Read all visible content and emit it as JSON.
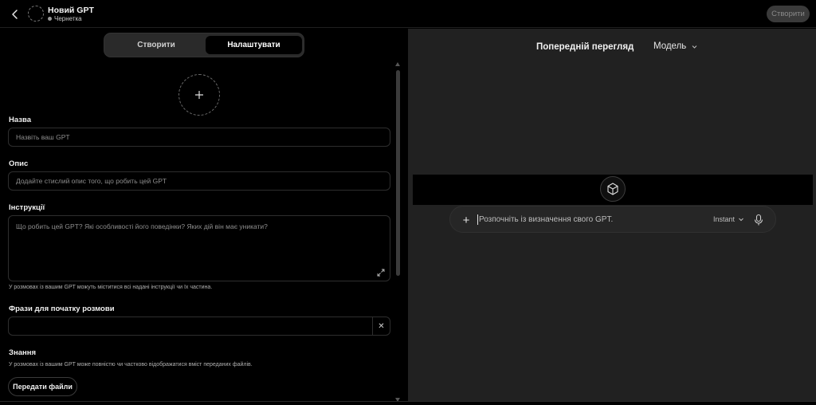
{
  "header": {
    "title": "Новий GPT",
    "status": "Чернетка",
    "create_label": "Створити"
  },
  "tabs": {
    "create": "Створити",
    "configure": "Налаштувати",
    "active": "configure"
  },
  "form": {
    "name_label": "Назва",
    "name_placeholder": "Назвіть ваш GPT",
    "description_label": "Опис",
    "description_placeholder": "Додайте стислий опис того, що робить цей GPT",
    "instructions_label": "Інструкції",
    "instructions_placeholder": "Що робить цей GPT? Які особливості його поведінки? Яких дій він має уникати?",
    "instructions_hint": "У розмовах із вашим GPT можуть міститися всі надані інструкції чи їх частина.",
    "starters_label": "Фрази для початку розмови",
    "starters_value": "",
    "knowledge_label": "Знання",
    "knowledge_hint": "У розмовах із вашим GPT може повністю чи частково відображатися вміст переданих файлів.",
    "upload_label": "Передати файли"
  },
  "preview": {
    "title": "Попередній перегляд",
    "model_label": "Модель",
    "composer_placeholder": "Розпочніть із визначення свого GPT.",
    "mode_label": "Instant"
  },
  "icons": [
    "back-arrow-icon",
    "gpt-avatar-placeholder-icon",
    "plus-icon",
    "expand-icon",
    "close-icon",
    "chevron-down-icon",
    "cube-icon",
    "microphone-icon"
  ],
  "colors": {
    "left_bg": "#000000",
    "right_bg": "#212121",
    "disabled_button_bg": "#3a3a3a"
  }
}
